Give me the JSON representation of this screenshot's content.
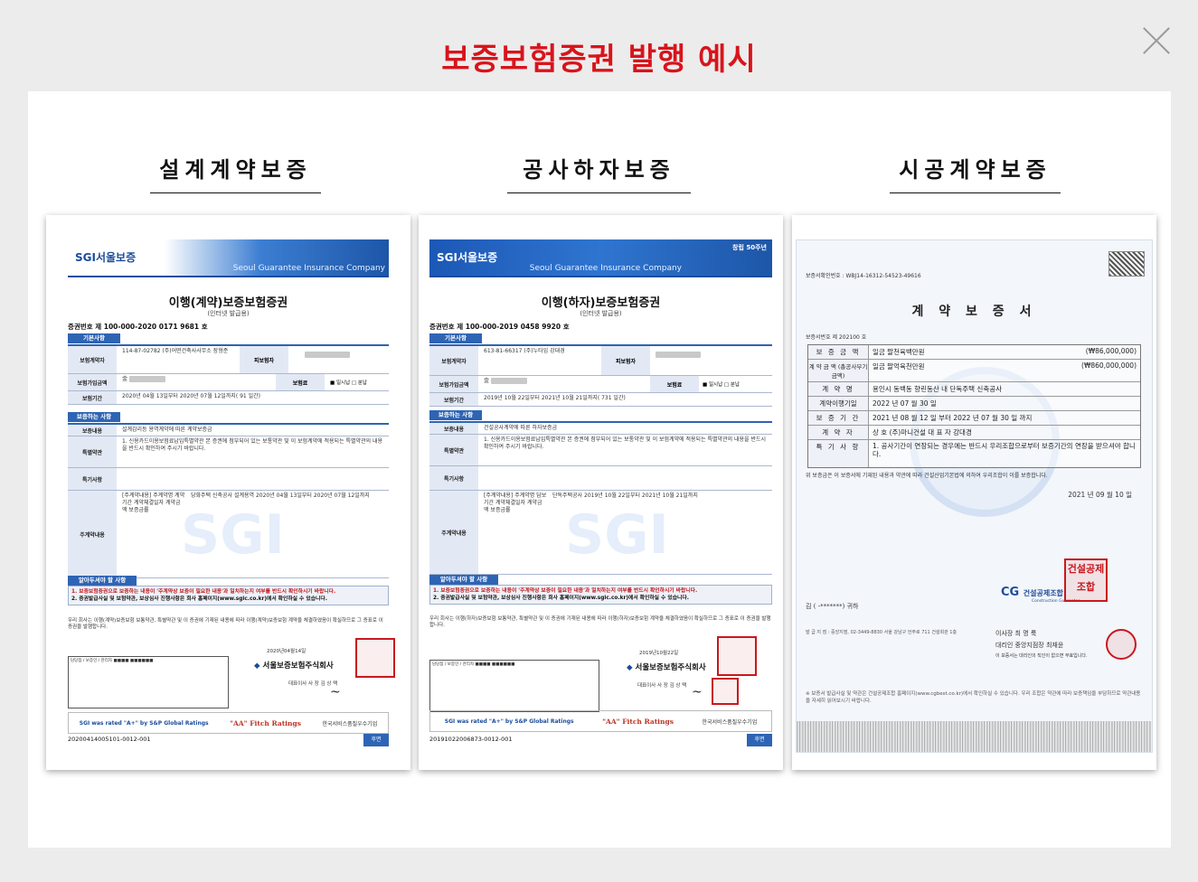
{
  "page": {
    "title": "보증보험증권 발행 예시",
    "close_label": "×"
  },
  "categories": [
    {
      "label": "설계계약보증"
    },
    {
      "label": "공사하자보증"
    },
    {
      "label": "시공계약보증"
    }
  ],
  "doc1": {
    "brand": "SGI서울보증",
    "brand_en": "Seoul Guarantee Insurance Company",
    "title": "이행(계약)보증보험증권",
    "subtitle": "(인터넷 발급용)",
    "number": "증권번호 제    100-000-2020 0171 9681 호",
    "section_basic": "기본사항",
    "contractor_label": "보험계약자",
    "contractor_value": "114-87-02782 (주)어떤건축사사무소 장형준",
    "insured_label": "피보험자",
    "amount_label": "보험가입금액",
    "amount_value": "金",
    "premium_label": "보험료",
    "premium_value": "■ 일시납 □ 분납",
    "period_label": "보험기간",
    "period_value": "2020년 04월 13일부터  2020년 07월 12일까지( 91 일간)",
    "section_guarantee": "보증하는 사항",
    "content_label": "보증내용",
    "content_value": "설계감리등 용역계약에 따른 계약보증금",
    "special_label": "특별약관",
    "special_value": "1. 신용카드이용보험료납입특별약관 본 증권에 첨부되어 있는 보통약관 및 이 보험계약에 적용되는 특별약관의 내용을 반드시 확인하여 주시기 바랍니다.",
    "special_items_label": "특기사항",
    "main_contract_label": "주계약내용",
    "main_contract_value": "[주계약내용] 주계약명 계약기간 계약체결일자 계약금액 보증금률",
    "main_contract_detail": "당화주택 신축공사 설계용역 2020년 04월 13일부터 2020년 07월 12일까지",
    "section_notice": "알아두셔야 할 사항",
    "notice1": "1. 보증보험증권으로 보증하는 내용이 '주계약상 보증이 필요한 내용'과 일치하는지 여부를 반드시 확인하시기 바랍니다.",
    "notice2": "2. 증권발급사실 및 보험약관, 보상심사 진행사항은 회사 홈페이지(www.sgic.co.kr)에서 확인하실 수 있습니다.",
    "body_text": "우리 회사는 이행(계약)보증보험 보통약관, 특별약관 및 이 증권에 기재된 내용에 따라 이행(계약)보증보험 계약을 체결하였음이 확실하므로 그 증표로 이 증권을 발행합니다.",
    "issue_date": "2020년04월14일",
    "company": "서울보증보험주식회사",
    "ceo": "대표이사 사 장  김 상 택",
    "rating1": "SGI was rated \"A+\" by S&P Global Ratings",
    "rating2": "\"AA\" Fitch Ratings",
    "rating3": "한국서비스품질우수기업",
    "footer_number": "20200414005101-0012-001",
    "next_label": "후면"
  },
  "doc2": {
    "brand": "SGI서울보증",
    "brand_en": "Seoul Guarantee Insurance Company",
    "anniv": "창립 50주년",
    "title": "이행(하자)보증보험증권",
    "subtitle": "(인터넷 발급용)",
    "number": "증권번호 제    100-000-2019 0458 9920 호",
    "section_basic": "기본사항",
    "contractor_label": "보험계약자",
    "contractor_value": "613-81-66317 (주)누타임 강대경",
    "insured_label": "피보험자",
    "amount_label": "보험가입금액",
    "amount_value": "金",
    "premium_label": "보험료",
    "premium_value": "■ 일시납 □ 분납",
    "period_label": "보험기간",
    "period_value": "2019년 10월 22일부터  2021년 10월 21일까지( 731 일간)",
    "section_guarantee": "보증하는 사항",
    "content_label": "보증내용",
    "content_value": "건설공사계약에 따른 하자보증금",
    "special_label": "특별약관",
    "special_value": "1. 신용카드이용보험료납입특별약관 본 증권에 첨부되어 있는 보통약관 및 이 보험계약에 적용되는 특별약관의 내용을 반드시 확인하여 주시기 바랍니다.",
    "special_items_label": "특기사항",
    "main_contract_label": "주계약내용",
    "main_contract_value": "[주계약내용] 주계약명 담보기간 계약체결일자 계약금액 보증금률",
    "main_contract_detail": "단독주택공사 2019년 10월 22일부터 2021년 10월 21일까지",
    "section_notice": "알아두셔야 할 사항",
    "notice1": "1. 보증보험증권으로 보증하는 내용이 '주계약상 보증이 필요한 내용'과 일치하는지 여부를 반드시 확인하시기 바랍니다.",
    "notice2": "2. 증권발급사실 및 보험약관, 보상심사 진행사항은 회사 홈페이지(www.sgic.co.kr)에서 확인하실 수 있습니다.",
    "body_text": "우리 회사는 이행(하자)보증보험 보통약관, 특별약관 및 이 증권에 기재된 내용에 따라 이행(하자)보증보험 계약을 체결하였음이 확실하므로 그 증표로 이 증권을 발행합니다.",
    "issue_date": "2019년10월22일",
    "company": "서울보증보험주식회사",
    "ceo": "대표이사 사 장  김 상 택",
    "rating1": "SGI was rated \"A+\" by S&P Global Ratings",
    "rating2": "\"AA\" Fitch Ratings",
    "rating3": "한국서비스품질우수기업",
    "footer_number": "20191022006873-0012-001",
    "next_label": "후면"
  },
  "doc3": {
    "cert_number": "보증서확인번호 :    WBJ14-16312-54523-49616",
    "title": "계 약 보 증 서",
    "doc_number": "보증서번호 제    202100                 호",
    "rows": [
      {
        "label": "보 증 금 액",
        "value": "일금 팔천육백만원",
        "extra": "(₩86,000,000)"
      },
      {
        "label": "계 약 금 액 (총공사부기금액)",
        "value": "일금 팔억육천만원",
        "extra": "(₩860,000,000)"
      },
      {
        "label": "계 약 명",
        "value": "용인시 동백동 향린동산 내 단독주택 신축공사",
        "extra": ""
      },
      {
        "label": "계약이행기일",
        "value": "2022 년 07 월 30 일",
        "extra": ""
      },
      {
        "label": "보 증 기 간",
        "value": "2021 년 08 월 12 일 부터 2022 년 07 월 30 일 까지",
        "extra": ""
      },
      {
        "label": "계 약 자",
        "value": "상 호  (주)마니건설          대 표 자  강대경",
        "extra": ""
      },
      {
        "label": "특 기 사 항",
        "value": "1. 공사기간이 연장되는 경우에는 반드시 우리조합으로부터 보증기간의 연장을 받으셔야 합니다.",
        "extra": ""
      }
    ],
    "statement": "위 보증금은 이 보증서에 기재된 내용과 약관에 따라 건설산업기본법에 의하여 우리조합이 이를 보증합니다.",
    "date": "2021 년 09 월 10 일",
    "recipient": "김      (        -*******) 귀하",
    "org_name": "건설공제조합",
    "org_name_en": "Construction Guarantee",
    "branch_info": "발 급 지 점 : 중앙지점,  02-3449-8830 서울 강남구 언주로 711 건설회관 1층",
    "chair": "이사장  최 명 룩",
    "agent": "대리인  중앙지점장  최재윤",
    "agent_note": "이 보증서는 대리인의 직인이 없으면 무효입니다.",
    "stamp_text": "건설공제조합",
    "footnote": "※ 보증서 발급사실 및 약관은 건설공제조합 홈페이지(www.cgbest.co.kr)에서 확인하실 수 있습니다. 우리 조합은 약관에 따라 보증책임을 부담하므로 약관내용을 자세히 읽어보시기 바랍니다."
  }
}
